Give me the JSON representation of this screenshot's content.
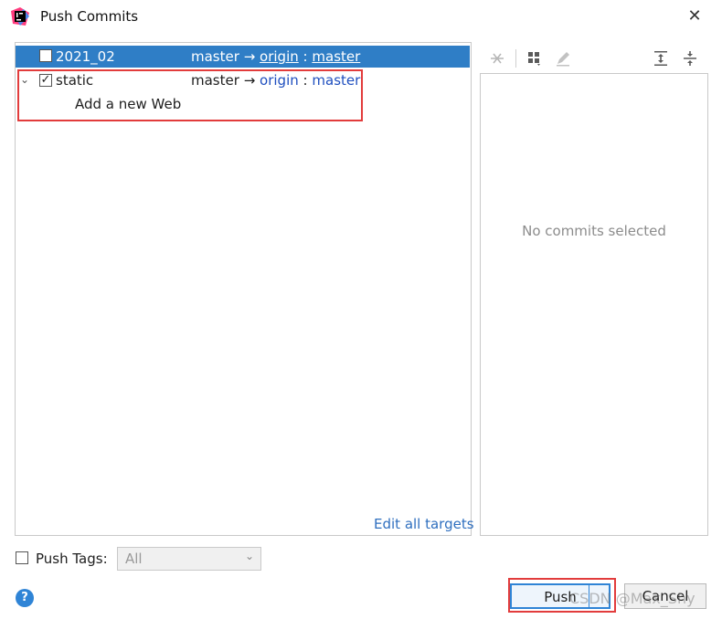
{
  "window": {
    "title": "Push Commits"
  },
  "repos": [
    {
      "name": "2021_02",
      "branch": "master",
      "arrow": "→",
      "remote": "origin",
      "colon": ":",
      "target": "master",
      "checked": false
    },
    {
      "name": "static",
      "branch": "master",
      "arrow": "→",
      "remote": "origin",
      "colon": ":",
      "target": "master",
      "checked": true,
      "commits": [
        "Add a new Web"
      ]
    }
  ],
  "edit_all_targets": "Edit all targets",
  "details": {
    "empty": "No commits selected"
  },
  "push_tags": {
    "label": "Push Tags:",
    "value": "All"
  },
  "buttons": {
    "push": "Push",
    "cancel": "Cancel"
  },
  "watermark": "CSDN @Max_Shy"
}
